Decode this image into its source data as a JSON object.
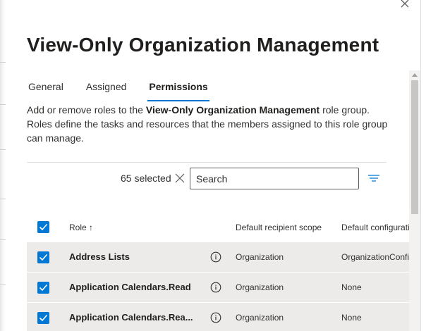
{
  "panel": {
    "title": "View-Only Organization Management"
  },
  "tabs": [
    {
      "label": "General"
    },
    {
      "label": "Assigned"
    },
    {
      "label": "Permissions"
    }
  ],
  "description": {
    "prefix": "Add or remove roles to the ",
    "group": "View-Only Organization Management",
    "suffix": " role group. Roles define the tasks and resources that the members assigned to this role group can manage."
  },
  "toolbar": {
    "selected_count": "65 selected",
    "search_placeholder": "Search"
  },
  "table": {
    "columns": {
      "role": "Role ↑",
      "scope": "Default recipient scope",
      "config": "Default configurati"
    },
    "rows": [
      {
        "role": "Address Lists",
        "scope": "Organization",
        "config": "OrganizationConfi"
      },
      {
        "role": "Application Calendars.Read",
        "scope": "Organization",
        "config": "None"
      },
      {
        "role": "Application Calendars.Rea...",
        "scope": "Organization",
        "config": "None"
      }
    ]
  },
  "colors": {
    "accent": "#0078d4",
    "row_selected_bg": "#edebe9"
  },
  "icons": [
    "close-icon",
    "clear-selection-icon",
    "filter-icon",
    "info-icon",
    "checkmark-icon"
  ]
}
